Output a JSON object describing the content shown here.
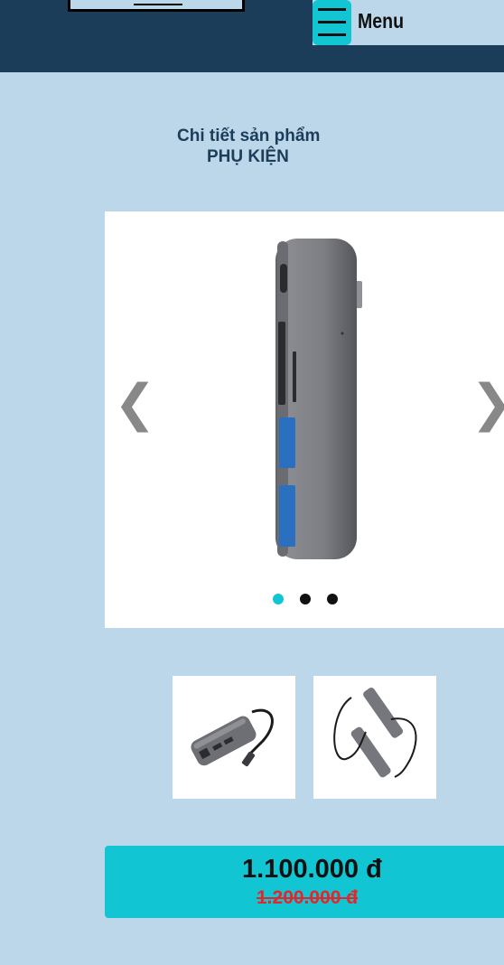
{
  "header": {
    "menu_label": "Menu",
    "menu_icon": "hamburger-icon",
    "accent_color": "#12c5d3",
    "bar_color": "#1b3d5a"
  },
  "heading": {
    "subtitle": "Chi tiết sản phẩm",
    "title": "PHỤ KIỆN"
  },
  "carousel": {
    "prev_symbol": "❮",
    "next_symbol": "❯",
    "slide_count": 3,
    "active_slide": 1,
    "slide_image": "usb-c-hub-product-image"
  },
  "thumbnails": [
    {
      "image": "usb-hub-with-ethernet-image"
    },
    {
      "image": "dual-usb-hubs-image"
    }
  ],
  "price": {
    "current": "1.100.000 đ",
    "original": "1.200.000 đ",
    "current_color": "#111111",
    "original_color": "#e3262b"
  }
}
